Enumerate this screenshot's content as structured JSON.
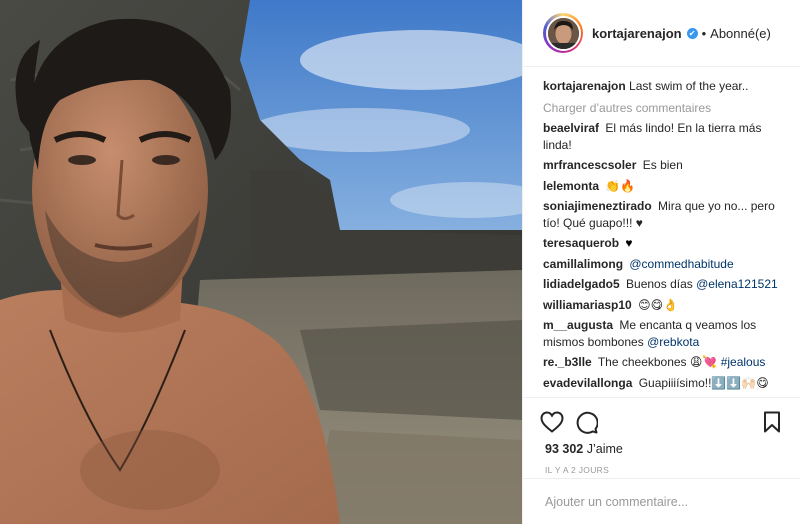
{
  "header": {
    "username": "kortajarenajon",
    "verified_mark": "✔",
    "separator": "•",
    "follow_label": "Abonné(e)"
  },
  "caption": {
    "username": "kortajarenajon",
    "text": "Last swim of the year.."
  },
  "load_more_label": "Charger d’autres commentaires",
  "comments": [
    {
      "user": "beaelviraf",
      "text": "El más lindo! En la tierra más linda!"
    },
    {
      "user": "mrfrancescsoler",
      "text": "Es bien"
    },
    {
      "user": "lelemonta",
      "text": "👏🔥"
    },
    {
      "user": "soniajimeneztirado",
      "text": "Mira que yo no... pero tío! Qué guapo!!! ♥"
    },
    {
      "user": "teresaquerob",
      "text": "♥"
    },
    {
      "user": "camillalimong",
      "mention": "@commedhabitude"
    },
    {
      "user": "lidiadelgado5",
      "text": "Buenos días",
      "mention": "@elena121521"
    },
    {
      "user": "williamariasp10",
      "text": "😊😋👌"
    },
    {
      "user": "m__augusta",
      "text": "Me encanta q veamos los mismos bombones",
      "mention": "@rebkota"
    },
    {
      "user": "re._b3lle",
      "text": "The cheekbones 😩💘",
      "mention": "#jealous"
    },
    {
      "user": "evadevilallonga",
      "text": "Guapiiiísimo!!⬇️⬇️🙌🏻😋"
    }
  ],
  "actions": {
    "like_icon": "heart-outline-icon",
    "comment_icon": "speech-bubble-icon",
    "save_icon": "bookmark-icon"
  },
  "likes": {
    "count": "93 302",
    "label": "J’aime"
  },
  "timestamp": "IL Y A 2 JOURS",
  "add_comment": {
    "placeholder": "Ajouter un commentaire..."
  },
  "colors": {
    "link": "#003569",
    "muted": "#999999",
    "verified": "#3897f0",
    "border": "#efefef"
  }
}
